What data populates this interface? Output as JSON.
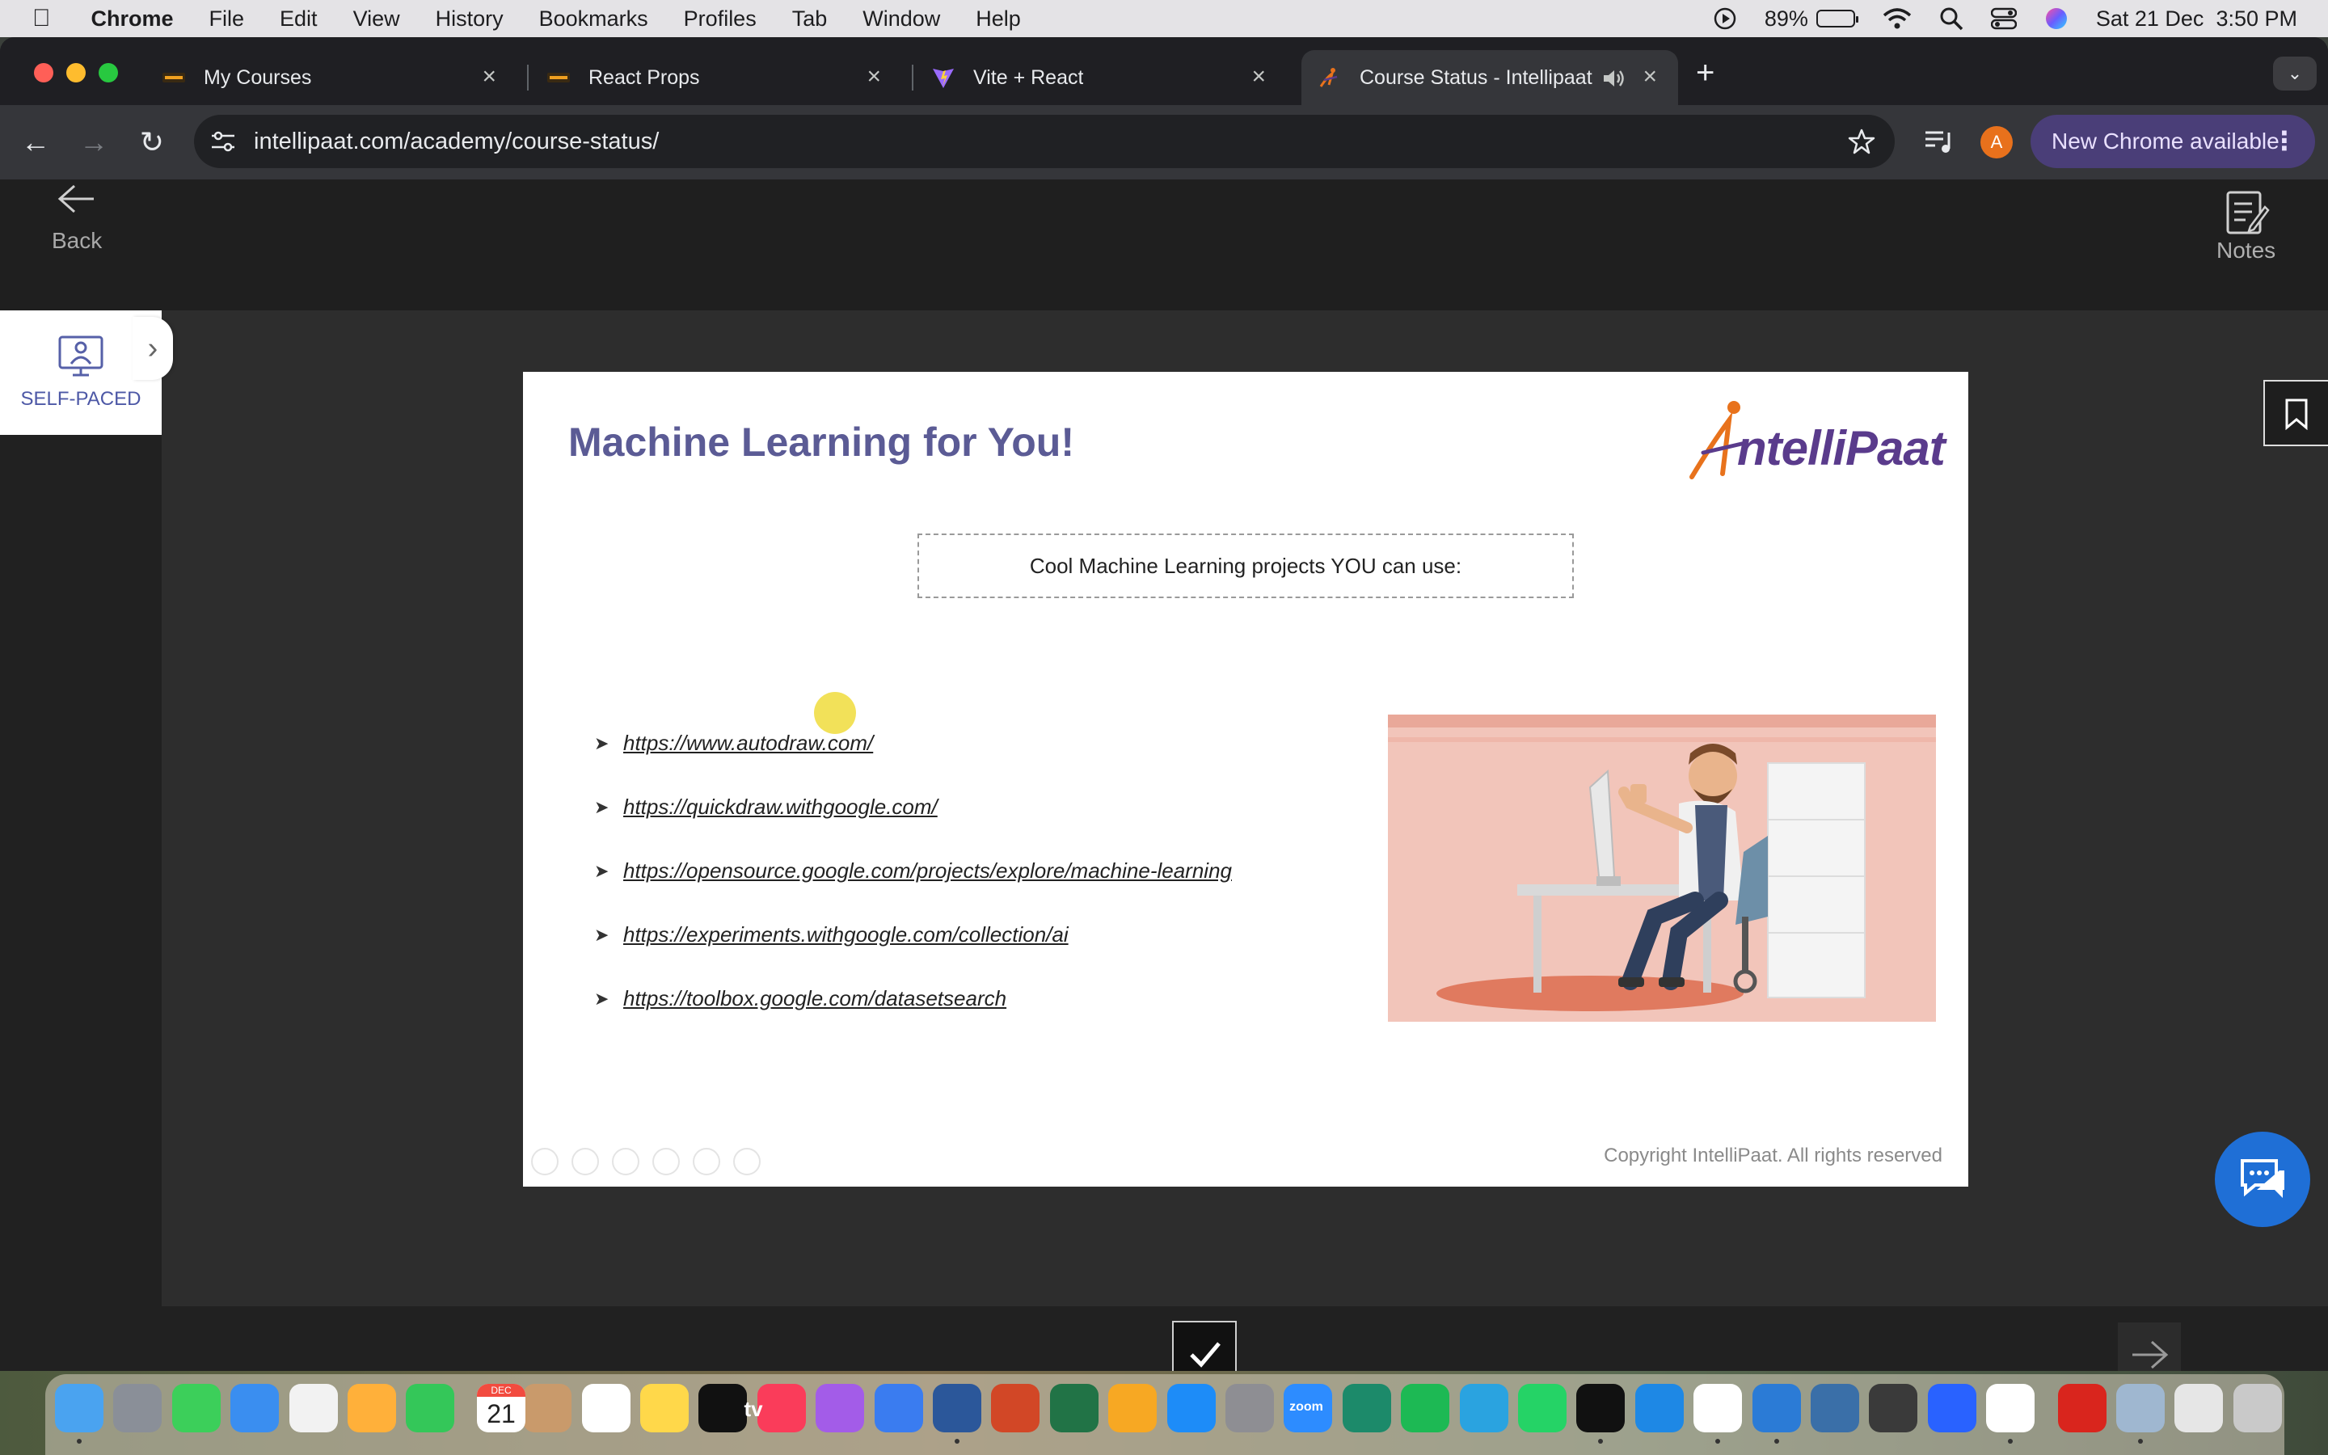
{
  "menubar": {
    "app_name": "Chrome",
    "menus": [
      "File",
      "Edit",
      "View",
      "History",
      "Bookmarks",
      "Profiles",
      "Tab",
      "Window",
      "Help"
    ],
    "battery_percent": "89%",
    "battery_level": 0.89,
    "datetime": "Sat 21 Dec  3:50 PM"
  },
  "tabs": [
    {
      "title": "My Courses",
      "favicon": "coursera-icon"
    },
    {
      "title": "React Props",
      "favicon": "coursera-icon"
    },
    {
      "title": "Vite + React",
      "favicon": "vite-icon"
    },
    {
      "title": "Course Status - Intellipaat",
      "favicon": "intellipaat-icon",
      "active": true,
      "audio": true
    }
  ],
  "toolbar": {
    "url": "intellipaat.com/academy/course-status/",
    "profile_initial": "A",
    "new_chrome_label": "New Chrome available"
  },
  "page": {
    "back_label": "Back",
    "notes_label": "Notes",
    "self_paced_label": "SELF-PACED"
  },
  "slide": {
    "title": "Machine Learning for You!",
    "logo_text": "ntelliPaat",
    "callout": "Cool Machine Learning projects YOU can use:",
    "links": [
      "https://www.autodraw.com/",
      "https://quickdraw.withgoogle.com/",
      "https://opensource.google.com/projects/explore/machine-learning",
      "https://experiments.withgoogle.com/collection/ai",
      "https://toolbox.google.com/datasetsearch"
    ],
    "copyright": "Copyright IntelliPaat. All rights reserved"
  },
  "dock": {
    "apps": [
      "Finder",
      "Launchpad",
      "Messages",
      "Mail",
      "Maps",
      "Photos",
      "FaceTime",
      "Calendar",
      "Contacts",
      "Reminders",
      "Notes",
      "TV",
      "Music",
      "Podcasts",
      "Keynote",
      "Word",
      "PowerPoint",
      "Excel",
      "Pages",
      "App Store",
      "System Settings",
      "Zoom",
      "Surfshark",
      "Spotify",
      "Telegram",
      "WhatsApp",
      "Terminal",
      "Safari",
      "Chrome",
      "VS Code",
      "MySQL Workbench",
      "Docker",
      "Hashnode",
      "Slack",
      "Acrobat",
      "Preview",
      "Documents",
      "Trash"
    ],
    "calendar_month": "DEC",
    "calendar_day": "21",
    "tv_label": "tv",
    "zoom_label": "zoom"
  },
  "colors": {
    "slide_title": "#5b5b95",
    "logo_orange": "#e8721c",
    "logo_purple": "#5a3b8c",
    "chat_blue": "#1f6fd6",
    "new_chrome_bg": "#4a3e78"
  }
}
